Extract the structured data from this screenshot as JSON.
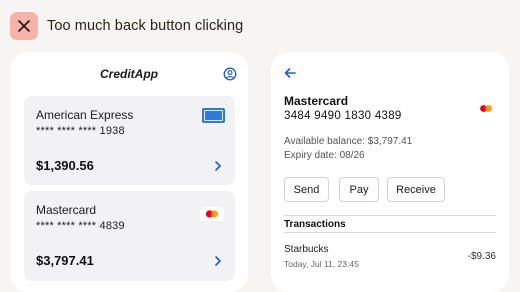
{
  "header": {
    "title": "Too much back button clicking",
    "badge_icon": "close-icon",
    "badge_color": "#f7b3aa"
  },
  "list_screen": {
    "app_title": "CreditApp",
    "profile_icon": "user-circle-icon",
    "accent_color": "#1f5bd6",
    "cards": [
      {
        "name": "American Express",
        "number": "**** **** **** 1938",
        "balance": "$1,390.56",
        "logo_icon": "amex-logo-icon"
      },
      {
        "name": "Mastercard",
        "number": "**** **** **** 4839",
        "balance": "$3,797.41",
        "logo_icon": "mastercard-logo-icon"
      }
    ]
  },
  "detail_screen": {
    "back_icon": "arrow-left-icon",
    "card_name": "Mastercard",
    "card_number": "3484 9490 1830 4389",
    "available_balance": "Available balance: $3,797.41",
    "expiry": "Expiry date: 08/26",
    "buttons": {
      "send": "Send",
      "pay": "Pay",
      "receive": "Receive"
    },
    "transactions_title": "Transactions",
    "transactions": [
      {
        "merchant": "Starbucks",
        "date": "Today, Jul 11, 23:45",
        "amount": "-$9.36"
      }
    ]
  }
}
